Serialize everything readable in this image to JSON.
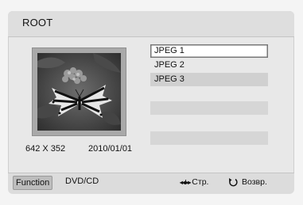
{
  "header": {
    "title": "ROOT"
  },
  "preview": {
    "resolution": "642 X 352",
    "date": "2010/01/01",
    "thumbnail_icon": "butterfly-photo-thumbnail"
  },
  "file_list": {
    "items": [
      {
        "label": "JPEG 1",
        "state": "selected"
      },
      {
        "label": "JPEG 2",
        "state": "normal"
      },
      {
        "label": "JPEG 3",
        "state": "normal"
      }
    ]
  },
  "footer": {
    "function_label": "Function",
    "source_label": "DVD/CD",
    "page_icon": "page-arrows-icon",
    "page_glyph": "◂◂/▸▸",
    "page_label": "Стр.",
    "back_icon": "return-arrow-icon",
    "back_label": "Возвр."
  },
  "colors": {
    "background": "#f4f4f4",
    "panel": "#e8e8e8",
    "selection_fill": "#ffffff",
    "row_fill": "#d6d6d6",
    "function_chip": "#bdbdbd"
  }
}
